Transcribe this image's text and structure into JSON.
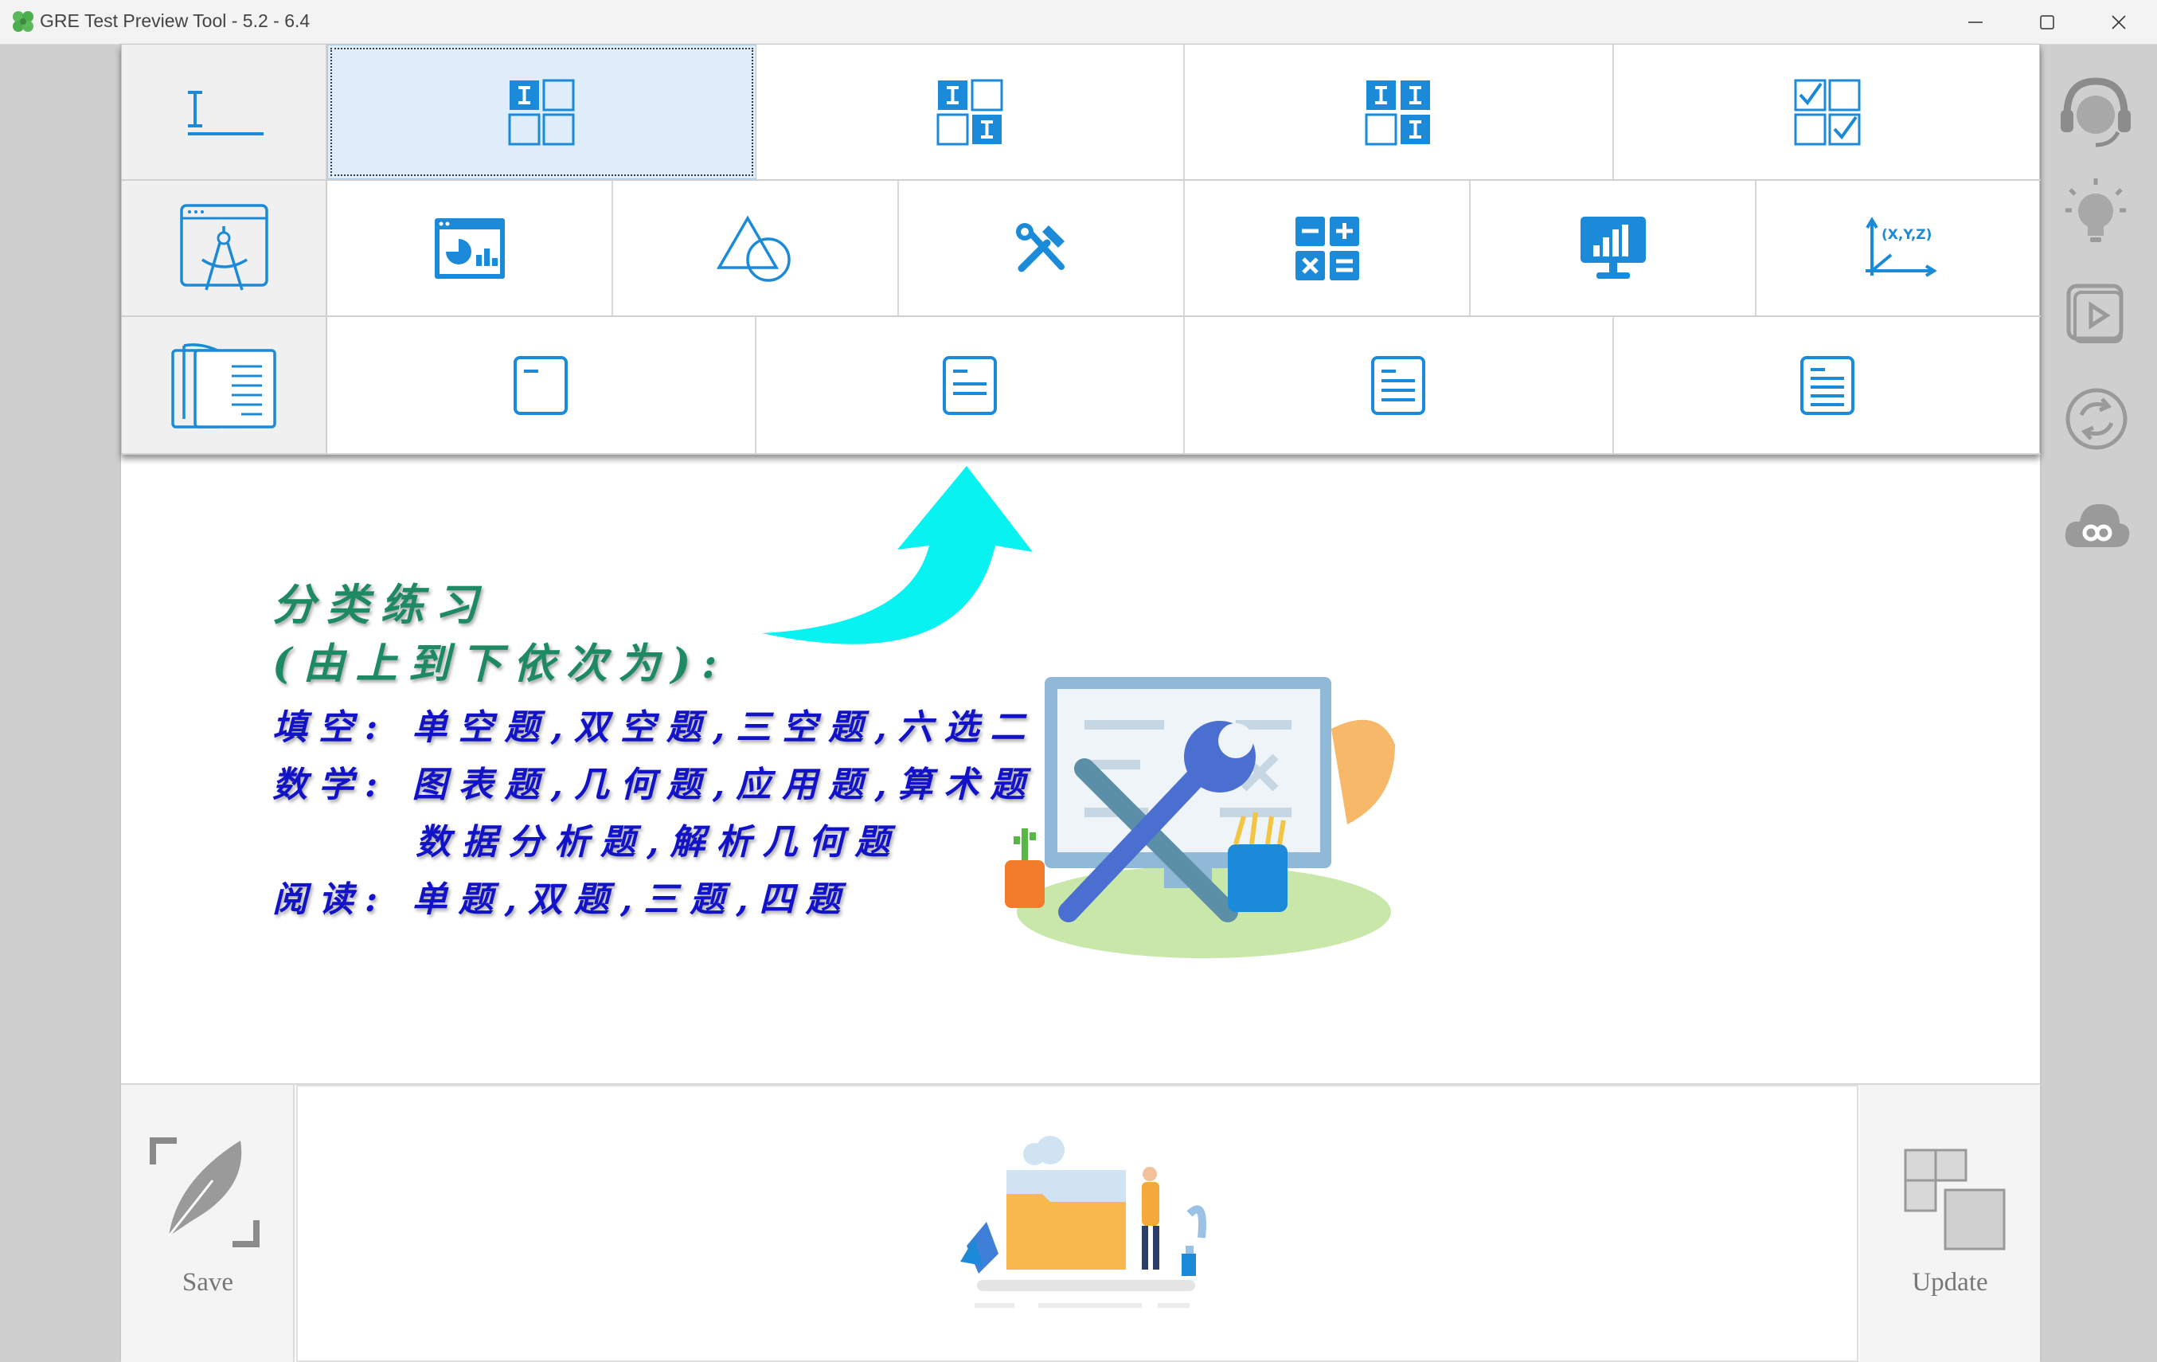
{
  "window": {
    "title": "GRE Test Preview Tool - 5.2 - 6.4",
    "min_glyph": "—",
    "max_glyph": "☐",
    "close_glyph": "✕"
  },
  "rows": [
    {
      "name": "fill",
      "icon": "text-cursor-underline-icon",
      "cells": [
        "single-blank-icon",
        "double-blank-icon",
        "triple-blank-icon",
        "select-two-checks-icon"
      ]
    },
    {
      "name": "math",
      "icon": "drawing-compass-board-icon",
      "cells": [
        "chart-window-icon",
        "triangle-circle-icon",
        "tools-crossed-icon",
        "calculator-ops-icon",
        "monitor-bar-chart-icon",
        "xyz-axes-icon"
      ]
    },
    {
      "name": "reading",
      "icon": "open-book-icon",
      "cells": [
        "document-one-line-icon",
        "document-two-lines-icon",
        "document-three-lines-icon",
        "document-four-lines-icon"
      ]
    }
  ],
  "note": {
    "title": "分类练习",
    "subtitle": "(由上到下依次为):",
    "fill_line": "填空: 单空题,双空题,三空题,六选二",
    "math_line": "数学: 图表题,几何题,应用题,算术题",
    "math_line2": "数据分析题,解析几何题",
    "reading_line": "阅读: 单题,双题,三题,四题"
  },
  "xyz_label": "(X,Y,Z)",
  "bottom": {
    "save_label": "Save",
    "update_label": "Update"
  },
  "sidebar": [
    "headset-support-icon",
    "lightbulb-icon",
    "play-video-icon",
    "refresh-icon",
    "cloud-link-icon"
  ],
  "colors": {
    "accent_blue": "#1b8ad8",
    "cyan_arrow": "#08f2f2",
    "note_green": "#1e8a63",
    "note_blue": "#1212c8"
  }
}
